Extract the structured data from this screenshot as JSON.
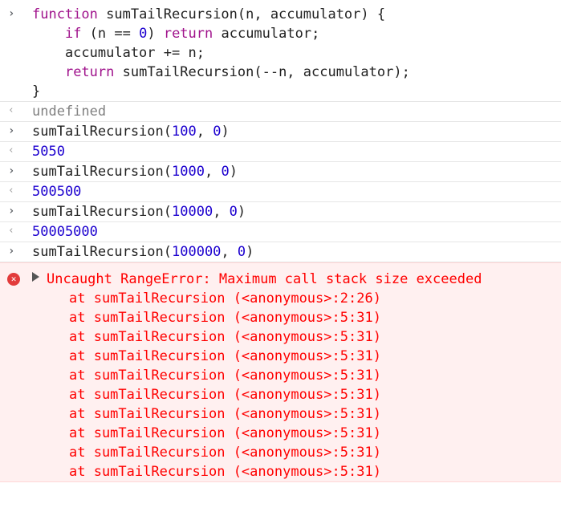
{
  "entries": [
    {
      "kind": "input",
      "lines": [
        [
          {
            "t": "function",
            "c": "kw"
          },
          {
            "t": " sumTailRecursion(n, accumulator) {",
            "c": "plain"
          }
        ],
        [
          {
            "t": "    ",
            "c": "plain"
          },
          {
            "t": "if",
            "c": "kw"
          },
          {
            "t": " (n == ",
            "c": "plain"
          },
          {
            "t": "0",
            "c": "num"
          },
          {
            "t": ") ",
            "c": "plain"
          },
          {
            "t": "return",
            "c": "kw"
          },
          {
            "t": " accumulator;",
            "c": "plain"
          }
        ],
        [
          {
            "t": "    accumulator += n;",
            "c": "plain"
          }
        ],
        [
          {
            "t": "    ",
            "c": "plain"
          },
          {
            "t": "return",
            "c": "kw"
          },
          {
            "t": " sumTailRecursion(--n, accumulator);",
            "c": "plain"
          }
        ],
        [
          {
            "t": "}",
            "c": "plain"
          }
        ]
      ]
    },
    {
      "kind": "output",
      "lines": [
        [
          {
            "t": "undefined",
            "c": "undef"
          }
        ]
      ]
    },
    {
      "kind": "input",
      "lines": [
        [
          {
            "t": "sumTailRecursion(",
            "c": "plain"
          },
          {
            "t": "100",
            "c": "num"
          },
          {
            "t": ", ",
            "c": "plain"
          },
          {
            "t": "0",
            "c": "num"
          },
          {
            "t": ")",
            "c": "plain"
          }
        ]
      ]
    },
    {
      "kind": "output",
      "lines": [
        [
          {
            "t": "5050",
            "c": "ret-num"
          }
        ]
      ]
    },
    {
      "kind": "input",
      "lines": [
        [
          {
            "t": "sumTailRecursion(",
            "c": "plain"
          },
          {
            "t": "1000",
            "c": "num"
          },
          {
            "t": ", ",
            "c": "plain"
          },
          {
            "t": "0",
            "c": "num"
          },
          {
            "t": ")",
            "c": "plain"
          }
        ]
      ]
    },
    {
      "kind": "output",
      "lines": [
        [
          {
            "t": "500500",
            "c": "ret-num"
          }
        ]
      ]
    },
    {
      "kind": "input",
      "lines": [
        [
          {
            "t": "sumTailRecursion(",
            "c": "plain"
          },
          {
            "t": "10000",
            "c": "num"
          },
          {
            "t": ", ",
            "c": "plain"
          },
          {
            "t": "0",
            "c": "num"
          },
          {
            "t": ")",
            "c": "plain"
          }
        ]
      ]
    },
    {
      "kind": "output",
      "lines": [
        [
          {
            "t": "50005000",
            "c": "ret-num"
          }
        ]
      ]
    },
    {
      "kind": "input",
      "lines": [
        [
          {
            "t": "sumTailRecursion(",
            "c": "plain"
          },
          {
            "t": "100000",
            "c": "num"
          },
          {
            "t": ", ",
            "c": "plain"
          },
          {
            "t": "0",
            "c": "num"
          },
          {
            "t": ")",
            "c": "plain"
          }
        ]
      ]
    }
  ],
  "error": {
    "message": "Uncaught RangeError: Maximum call stack size exceeded",
    "frames": [
      "at sumTailRecursion (<anonymous>:2:26)",
      "at sumTailRecursion (<anonymous>:5:31)",
      "at sumTailRecursion (<anonymous>:5:31)",
      "at sumTailRecursion (<anonymous>:5:31)",
      "at sumTailRecursion (<anonymous>:5:31)",
      "at sumTailRecursion (<anonymous>:5:31)",
      "at sumTailRecursion (<anonymous>:5:31)",
      "at sumTailRecursion (<anonymous>:5:31)",
      "at sumTailRecursion (<anonymous>:5:31)",
      "at sumTailRecursion (<anonymous>:5:31)"
    ]
  },
  "icons": {
    "input_prompt": "chevron-right-icon",
    "output_prompt": "return-arrow-icon",
    "error": "error-circle-icon",
    "expand": "triangle-right-icon"
  },
  "colors": {
    "keyword": "#a0138c",
    "number": "#1c00cf",
    "error_text": "#ff0000",
    "error_bg": "#fff0f0"
  }
}
